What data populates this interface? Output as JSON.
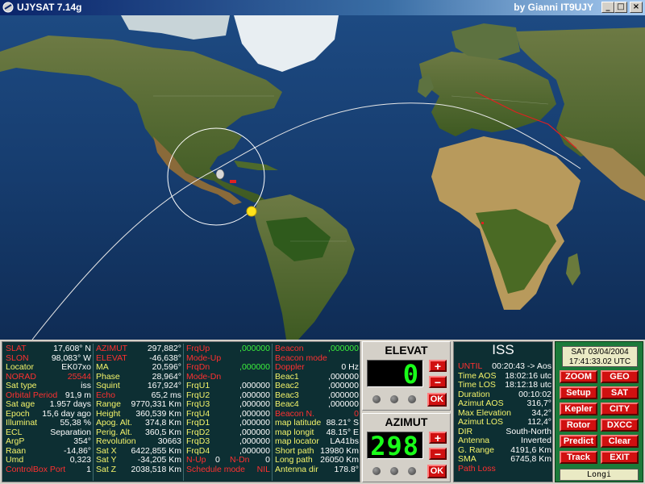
{
  "window": {
    "title": "UJYSAT 7.14g",
    "author": "by Gianni IT9UJY",
    "min_label": "_",
    "max_label": "□",
    "close_label": "×"
  },
  "col1": [
    {
      "k": "SLAT",
      "v": "17,608° N",
      "kc": "r",
      "vc": "w"
    },
    {
      "k": "SLON",
      "v": "98,083° W",
      "kc": "r",
      "vc": "w"
    },
    {
      "k": "Locator",
      "v": "EK07xo",
      "kc": "y",
      "vc": "w"
    },
    {
      "k": "NORAD",
      "v": "25544",
      "kc": "r",
      "vc": "r"
    },
    {
      "k": "Sat type",
      "v": "iss",
      "kc": "y",
      "vc": "w"
    },
    {
      "k": "Orbital Period",
      "v": "91,9 m",
      "kc": "r",
      "vc": "w"
    },
    {
      "k": "Sat age",
      "v": "1.957 days",
      "kc": "y",
      "vc": "w"
    },
    {
      "k": "Epoch",
      "v": "15,6 day ago",
      "kc": "y",
      "vc": "w"
    },
    {
      "k": "Illuminat",
      "v": "55,38 %",
      "kc": "y",
      "vc": "w"
    },
    {
      "k": "ECL",
      "v": "Separation",
      "kc": "y",
      "vc": "w"
    },
    {
      "k": "ArgP",
      "v": "354°",
      "kc": "y",
      "vc": "w"
    },
    {
      "k": "Raan",
      "v": "-14,86°",
      "kc": "y",
      "vc": "w"
    },
    {
      "k": "Umd",
      "v": "0,323",
      "kc": "y",
      "vc": "w"
    },
    {
      "k": "ControlBox Port",
      "v": "1",
      "kc": "r",
      "vc": "w"
    }
  ],
  "col2": [
    {
      "k": "AZIMUT",
      "v": "297,882°",
      "kc": "r",
      "vc": "w"
    },
    {
      "k": "ELEVAT",
      "v": "-46,638°",
      "kc": "r",
      "vc": "w"
    },
    {
      "k": "MA",
      "v": "20,596°",
      "kc": "y",
      "vc": "w"
    },
    {
      "k": "Phase",
      "v": "28,964°",
      "kc": "y",
      "vc": "w"
    },
    {
      "k": "Squint",
      "v": "167,924°",
      "kc": "y",
      "vc": "w"
    },
    {
      "k": "Echo",
      "v": "65,2 ms",
      "kc": "r",
      "vc": "w"
    },
    {
      "k": "Range",
      "v": "9770,331 Km",
      "kc": "y",
      "vc": "w"
    },
    {
      "k": "Height",
      "v": "360,539 Km",
      "kc": "y",
      "vc": "w"
    },
    {
      "k": "Apog. Alt.",
      "v": "374,8 Km",
      "kc": "y",
      "vc": "w"
    },
    {
      "k": "Perig. Alt.",
      "v": "360,5 Km",
      "kc": "y",
      "vc": "w"
    },
    {
      "k": "Revolution",
      "v": "30663",
      "kc": "y",
      "vc": "w"
    },
    {
      "k": "Sat X",
      "v": "6422,855 Km",
      "kc": "y",
      "vc": "w"
    },
    {
      "k": "Sat Y",
      "v": "-34,205 Km",
      "kc": "y",
      "vc": "w"
    },
    {
      "k": "Sat Z",
      "v": "2038,518 Km",
      "kc": "y",
      "vc": "w"
    }
  ],
  "col3": [
    {
      "k": "FrqUp",
      "v": ",000000",
      "kc": "r",
      "vc": "g"
    },
    {
      "k": "Mode-Up",
      "v": "",
      "kc": "r",
      "vc": "w"
    },
    {
      "k": "FrqDn",
      "v": ",000000",
      "kc": "r",
      "vc": "g"
    },
    {
      "k": "Mode-Dn",
      "v": "",
      "kc": "r",
      "vc": "w"
    },
    {
      "k": "FrqU1",
      "v": ",000000",
      "kc": "y",
      "vc": "w"
    },
    {
      "k": "FrqU2",
      "v": ",000000",
      "kc": "y",
      "vc": "w"
    },
    {
      "k": "FrqU3",
      "v": ",000000",
      "kc": "y",
      "vc": "w"
    },
    {
      "k": "FrqU4",
      "v": ",000000",
      "kc": "y",
      "vc": "w"
    },
    {
      "k": "FrqD1",
      "v": ",000000",
      "kc": "y",
      "vc": "w"
    },
    {
      "k": "FrqD2",
      "v": ",000000",
      "kc": "y",
      "vc": "w"
    },
    {
      "k": "FrqD3",
      "v": ",000000",
      "kc": "y",
      "vc": "w"
    },
    {
      "k": "FrqD4",
      "v": ",000000",
      "kc": "y",
      "vc": "w"
    },
    {
      "k": "N-Up",
      "v": "0",
      "kc": "r",
      "vc": "w",
      "k2": "N-Dn",
      "v2": "0"
    },
    {
      "k": "Schedule mode",
      "v": "NIL",
      "kc": "r",
      "vc": "r"
    }
  ],
  "col4": [
    {
      "k": "Beacon",
      "v": ",000000",
      "kc": "r",
      "vc": "g"
    },
    {
      "k": "Beacon mode",
      "v": "",
      "kc": "r",
      "vc": "w"
    },
    {
      "k": "Doppler",
      "v": "0 Hz",
      "kc": "r",
      "vc": "w"
    },
    {
      "k": "Beac1",
      "v": ",000000",
      "kc": "y",
      "vc": "w"
    },
    {
      "k": "Beac2",
      "v": ",000000",
      "kc": "y",
      "vc": "w"
    },
    {
      "k": "Beac3",
      "v": ",000000",
      "kc": "y",
      "vc": "w"
    },
    {
      "k": "Beac4",
      "v": ",000000",
      "kc": "y",
      "vc": "w"
    },
    {
      "k": "Beacon N.",
      "v": "0",
      "kc": "r",
      "vc": "r"
    },
    {
      "k": "map latitude",
      "v": "88.21° S",
      "kc": "y",
      "vc": "w"
    },
    {
      "k": "map longit",
      "v": "48.15° E",
      "kc": "y",
      "vc": "w"
    },
    {
      "k": "map locator",
      "v": "LA41bs",
      "kc": "y",
      "vc": "w"
    },
    {
      "k": "Short path",
      "v": "13980 Km",
      "kc": "y",
      "vc": "w"
    },
    {
      "k": "Long path",
      "v": "26050 Km",
      "kc": "y",
      "vc": "w"
    },
    {
      "k": "Antenna dir",
      "v": "178.8°",
      "kc": "y",
      "vc": "w"
    }
  ],
  "elevat": {
    "title": "ELEVAT",
    "value": "0",
    "plus": "+",
    "minus": "−",
    "ok": "OK"
  },
  "azimut": {
    "title": "AZIMUT",
    "value": "298",
    "plus": "+",
    "minus": "−",
    "ok": "OK"
  },
  "iss": {
    "name": "ISS",
    "rows": [
      {
        "k": "UNTIL",
        "v": "00:20:43 -> Aos",
        "kc": "r",
        "vc": "w"
      },
      {
        "k": "Time AOS",
        "v": "18:02:16 utc",
        "kc": "y",
        "vc": "w"
      },
      {
        "k": "Time LOS",
        "v": "18:12:18 utc",
        "kc": "y",
        "vc": "w"
      },
      {
        "k": "Duration",
        "v": "00:10:02",
        "kc": "y",
        "vc": "w"
      },
      {
        "k": "Azimut AOS",
        "v": "316,7°",
        "kc": "y",
        "vc": "w"
      },
      {
        "k": "Max Elevation",
        "v": "34,2°",
        "kc": "y",
        "vc": "w"
      },
      {
        "k": "Azimut LOS",
        "v": "112,4°",
        "kc": "y",
        "vc": "w"
      },
      {
        "k": "DIR",
        "v": "South-North",
        "kc": "y",
        "vc": "w"
      },
      {
        "k": "Antenna",
        "v": "Inverted",
        "kc": "y",
        "vc": "w"
      },
      {
        "k": "G. Range",
        "v": "4191,6 Km",
        "kc": "y",
        "vc": "w"
      },
      {
        "k": "SMA",
        "v": "6745,8 Km",
        "kc": "y",
        "vc": "w"
      },
      {
        "k": "Path Loss",
        "v": "",
        "kc": "r",
        "vc": "w"
      }
    ]
  },
  "datetime": {
    "date": "SAT 03/04/2004",
    "time": "17:41:33.02 UTC"
  },
  "buttons": {
    "zoom": "ZOOM",
    "geo": "GEO",
    "setup": "Setup",
    "sat": "SAT",
    "kepler": "Kepler",
    "city": "CITY",
    "rotor": "Rotor",
    "dxcc": "DXCC",
    "predict": "Predict",
    "clear": "Clear",
    "track": "Track",
    "exit": "EXIT"
  },
  "location": "Longi",
  "colors": {
    "panel_bg": "#0d2f33",
    "label_yellow": "#f4f46a",
    "label_red": "#ff3030",
    "lcd_green": "#19ff19",
    "button_red": "#d01010",
    "ocean": "#163c6e"
  }
}
